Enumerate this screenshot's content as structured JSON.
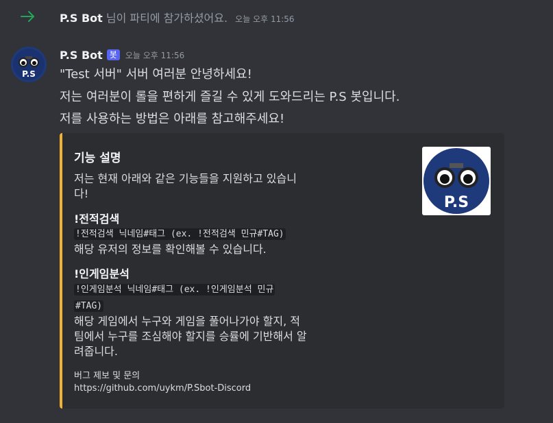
{
  "system": {
    "username": "P.S Bot",
    "message": "님이 파티에 참가하셨어요.",
    "timestamp": "오늘 오후 11:56"
  },
  "message": {
    "author": "P.S Bot",
    "badge": "봇",
    "timestamp": "오늘 오후 11:56",
    "avatar_text": "P.S",
    "lines": [
      "\"Test 서버\" 서버 여러분 안녕하세요!",
      "저는 여러분이 롤을 편하게 즐길 수 있게 도와드리는 P.S 봇입니다.",
      "저를 사용하는 방법은 아래를 참고해주세요!"
    ]
  },
  "embed": {
    "accent_color": "#f0b232",
    "title": "기능 설명",
    "description_line1": "저는 현재 아래와 같은 기능들을 지원하고 있습니",
    "description_line2": "다!",
    "thumbnail_text": "P.S",
    "fields": [
      {
        "name": "!전적검색",
        "code_line1": "!전적검색 닉네임#태그 (ex. !전적검색 민규#TAG)",
        "code_line2": "",
        "text_lines": [
          "해당 유저의 정보를 확인해볼 수 있습니다."
        ]
      },
      {
        "name": "!인게임분석",
        "code_line1": "!인게임분석 닉네임#태그 (ex. !인게임분석 민규",
        "code_line2": "#TAG)",
        "text_lines": [
          "해당 게임에서 누구와 게임을 풀어나가야 할지, 적",
          "팀에서 누구를 조심해야 할지를 승률에 기반해서 알",
          "려줍니다."
        ]
      }
    ],
    "footer_label": "버그 제보 및 문의",
    "footer_url": "https://github.com/uykm/P.Sbot-Discord"
  }
}
